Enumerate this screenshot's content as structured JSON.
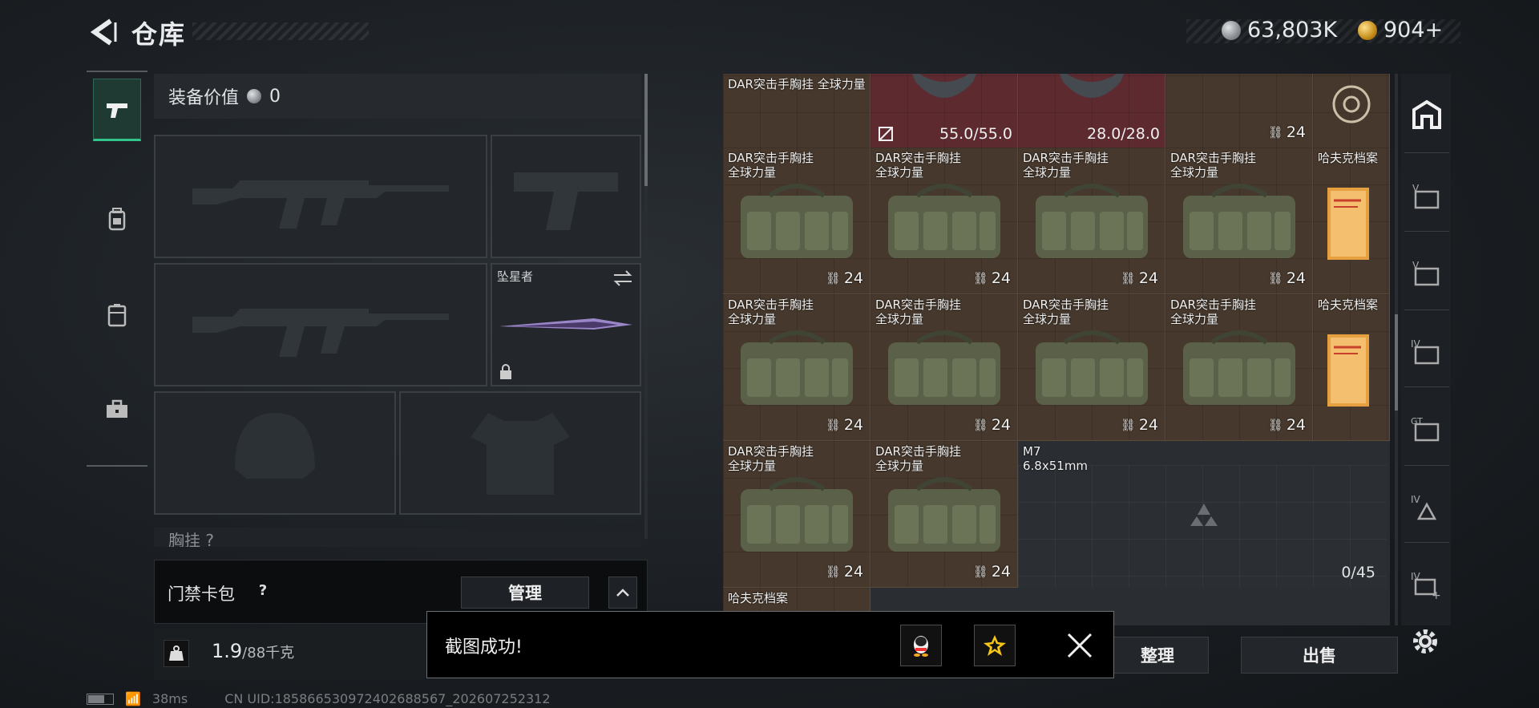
{
  "header": {
    "title": "仓库",
    "currency_silver": "63,803K",
    "currency_gold": "904+"
  },
  "equipment": {
    "value_label": "装备价值",
    "value": "0",
    "melee_name": "坠星者",
    "next_section": "胸挂 ?"
  },
  "keycard": {
    "label": "门禁卡包",
    "help": "?",
    "manage_label": "管理"
  },
  "weight": {
    "current": "1.9",
    "max": "/88千克"
  },
  "storage": {
    "top_row": [
      {
        "name": "DAR突击手胸挂\n全球力量",
        "type": "rig"
      },
      {
        "durability": "55.0/55.0",
        "type": "helmet"
      },
      {
        "durability": "28.0/28.0",
        "type": "helmet"
      },
      {
        "count": "24",
        "type": "rig"
      },
      {
        "type": "target"
      }
    ],
    "rows": [
      [
        {
          "name": "DAR突击手胸挂\n全球力量",
          "count": "24"
        },
        {
          "name": "DAR突击手胸挂\n全球力量",
          "count": "24"
        },
        {
          "name": "DAR突击手胸挂\n全球力量",
          "count": "24"
        },
        {
          "name": "DAR突击手胸挂\n全球力量",
          "count": "24"
        },
        {
          "name": "哈夫克档案",
          "type": "doc"
        }
      ],
      [
        {
          "name": "DAR突击手胸挂\n全球力量",
          "count": "24"
        },
        {
          "name": "DAR突击手胸挂\n全球力量",
          "count": "24"
        },
        {
          "name": "DAR突击手胸挂\n全球力量",
          "count": "24"
        },
        {
          "name": "DAR突击手胸挂\n全球力量",
          "count": "24"
        },
        {
          "name": "哈夫克档案",
          "type": "doc"
        }
      ],
      [
        {
          "name": "DAR突击手胸挂\n全球力量",
          "count": "24"
        },
        {
          "name": "DAR突击手胸挂\n全球力量",
          "count": "24"
        },
        {
          "name": "M7\n6.8x51mm",
          "type": "ammo"
        }
      ],
      [
        {
          "name": "哈夫克档案",
          "type": "doc"
        }
      ]
    ],
    "capacity": "0/45"
  },
  "actions": {
    "sort_label": "整理",
    "sell_label": "出售"
  },
  "toast": {
    "message": "截图成功!"
  },
  "status": {
    "ping": "38ms",
    "uid": "CN UID:1858665309724026885​67_202607252312"
  },
  "colors": {
    "accent_green": "#33c48e",
    "cell_brown": "#46382c",
    "cell_red": "#5d2a30"
  }
}
